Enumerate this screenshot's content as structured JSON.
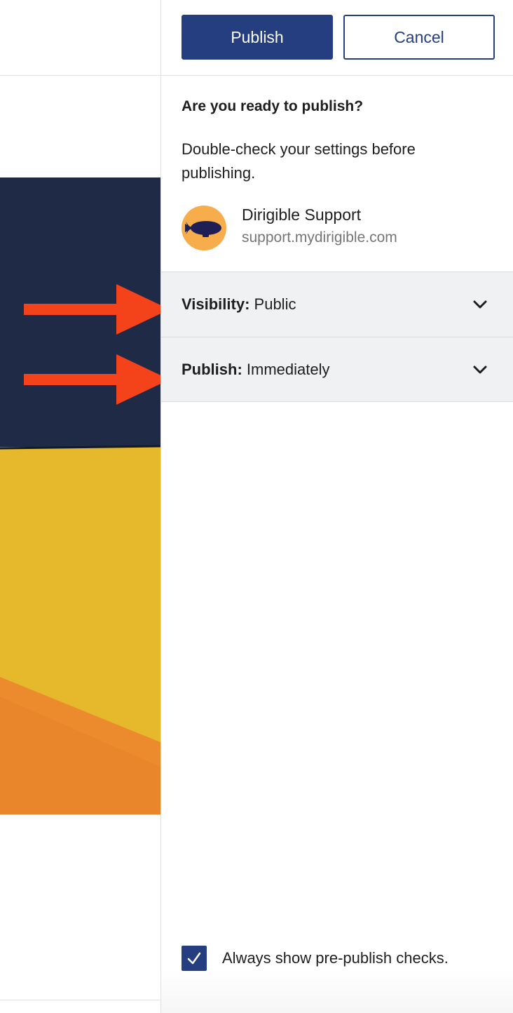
{
  "header": {
    "publish_label": "Publish",
    "cancel_label": "Cancel"
  },
  "prepublish": {
    "title": "Are you ready to publish?",
    "description": "Double-check your settings before publishing."
  },
  "site": {
    "name": "Dirigible Support",
    "url": "support.mydirigible.com",
    "logo_icon": "blimp-icon",
    "logo_color": "#f7ad4c"
  },
  "panels": [
    {
      "key": "Visibility:",
      "value": "Public",
      "icon": "chevron-down-icon"
    },
    {
      "key": "Publish:",
      "value": "Immediately",
      "icon": "chevron-down-icon"
    }
  ],
  "footer": {
    "checkbox_checked": true,
    "checkbox_label": "Always show pre-publish checks."
  },
  "annotations": {
    "arrow_color": "#f4421b",
    "arrow_count": 2
  },
  "colors": {
    "primary": "#253e80",
    "panel_bg": "#f0f1f3",
    "image_navy": "#1e2a46",
    "image_yellow": "#e6b82c",
    "image_orange": "#ec8b2e"
  }
}
